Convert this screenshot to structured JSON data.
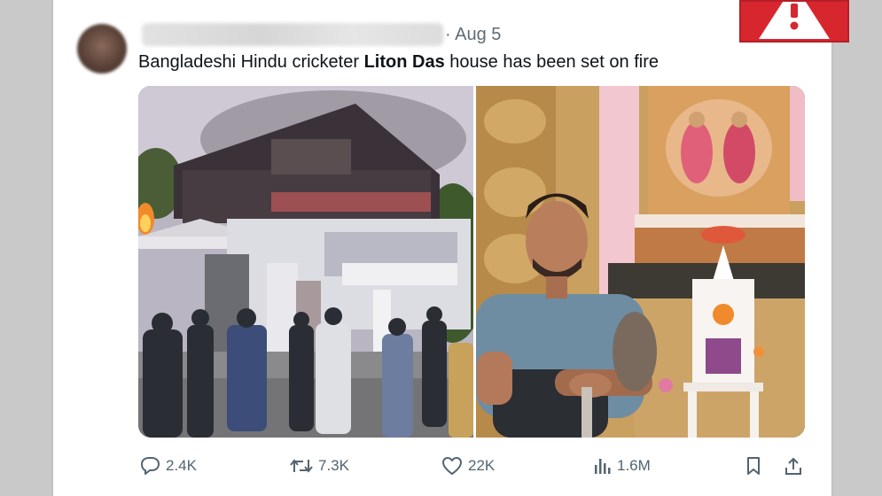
{
  "tweet": {
    "date": "· Aug 5",
    "text_before": "Bangladeshi Hindu cricketer ",
    "text_bold": "Liton Das",
    "text_after": " house has been set on fire"
  },
  "actions": {
    "replies": "2.4K",
    "retweets": "7.3K",
    "likes": "22K",
    "views": "1.6M"
  },
  "colors": {
    "warning": "#d8262f",
    "text": "#0f1419",
    "muted": "#536471"
  },
  "icons": [
    "warning-icon",
    "reply-icon",
    "retweet-icon",
    "like-icon",
    "views-icon",
    "bookmark-icon",
    "share-icon"
  ]
}
